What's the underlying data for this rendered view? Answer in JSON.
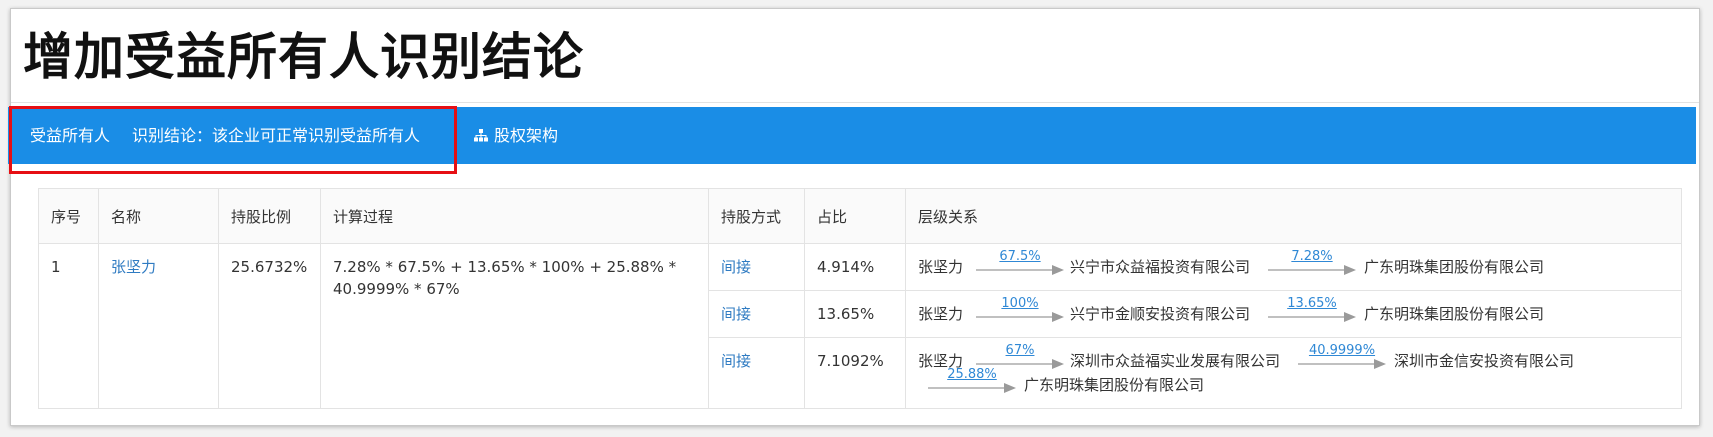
{
  "page": {
    "title": "增加受益所有人识别结论"
  },
  "bar": {
    "label": "受益所有人",
    "conclusion": "识别结论：该企业可正常识别受益所有人",
    "equity_link": "股权架构",
    "equity_icon": "sitemap-icon",
    "background": "#1a8de6",
    "highlight_color": "#e60f14"
  },
  "table": {
    "headers": [
      "序号",
      "名称",
      "持股比例",
      "计算过程",
      "持股方式",
      "占比",
      "层级关系"
    ],
    "rows": [
      {
        "index": "1",
        "name": "张坚力",
        "share_ratio": "25.6732%",
        "calculation": "7.28% * 67.5% + 13.65% * 100% + 25.88% * 40.9999% * 67%",
        "paths": [
          {
            "method": "间接",
            "proportion": "4.914%",
            "chain": [
              {
                "entity": "张坚力"
              },
              {
                "pct": "67.5%"
              },
              {
                "entity": "兴宁市众益福投资有限公司"
              },
              {
                "pct": "7.28%"
              },
              {
                "entity": "广东明珠集团股份有限公司"
              }
            ]
          },
          {
            "method": "间接",
            "proportion": "13.65%",
            "chain": [
              {
                "entity": "张坚力"
              },
              {
                "pct": "100%"
              },
              {
                "entity": "兴宁市金顺安投资有限公司"
              },
              {
                "pct": "13.65%"
              },
              {
                "entity": "广东明珠集团股份有限公司"
              }
            ]
          },
          {
            "method": "间接",
            "proportion": "7.1092%",
            "chain": [
              {
                "entity": "张坚力"
              },
              {
                "pct": "67%"
              },
              {
                "entity": "深圳市众益福实业发展有限公司"
              },
              {
                "pct": "40.9999%"
              },
              {
                "entity": "深圳市金信安投资有限公司"
              },
              {
                "pct": "25.88%"
              },
              {
                "entity": "广东明珠集团股份有限公司"
              }
            ]
          }
        ]
      }
    ]
  }
}
